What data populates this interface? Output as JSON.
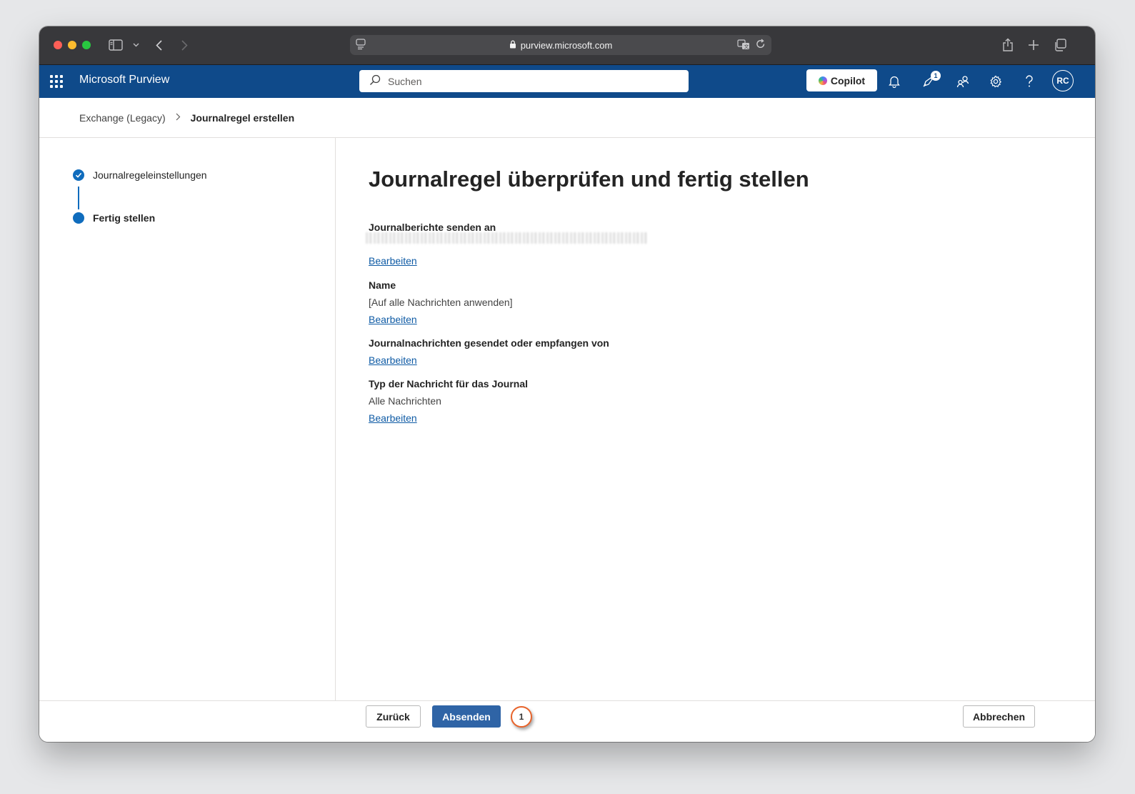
{
  "browser": {
    "url": "purview.microsoft.com"
  },
  "header": {
    "app_title": "Microsoft Purview",
    "search_placeholder": "Suchen",
    "copilot_label": "Copilot",
    "notification_badge": "1",
    "avatar_initials": "RC",
    "brand_color": "#0f4a8a"
  },
  "breadcrumb": {
    "parent": "Exchange (Legacy)",
    "current": "Journalregel erstellen"
  },
  "steps": [
    {
      "label": "Journalregeleinstellungen",
      "state": "completed"
    },
    {
      "label": "Fertig stellen",
      "state": "current"
    }
  ],
  "main": {
    "title": "Journalregel überprüfen und fertig stellen",
    "sections": [
      {
        "label": "Journalberichte senden an",
        "value": "",
        "edit": "Bearbeiten"
      },
      {
        "label": "Name",
        "value": "[Auf alle Nachrichten anwenden]",
        "edit": "Bearbeiten"
      },
      {
        "label": "Journalnachrichten gesendet oder empfangen von",
        "value": "",
        "edit": "Bearbeiten"
      },
      {
        "label": "Typ der Nachricht für das Journal",
        "value": "Alle Nachrichten",
        "edit": "Bearbeiten"
      }
    ]
  },
  "footer": {
    "back_label": "Zurück",
    "submit_label": "Absenden",
    "cancel_label": "Abbrechen",
    "marker_number": "1",
    "marker_color": "#e8632a"
  }
}
